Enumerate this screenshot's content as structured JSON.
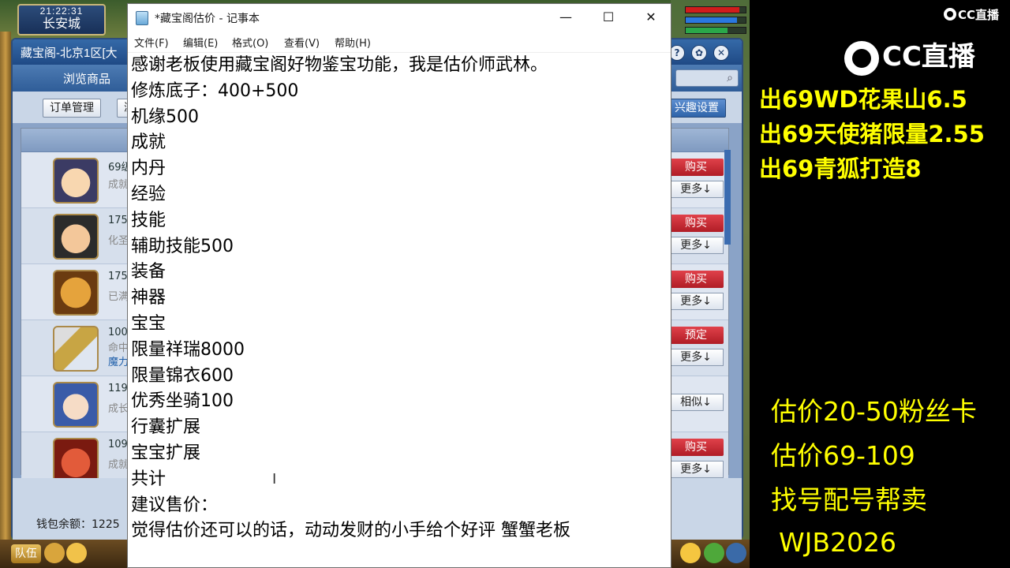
{
  "game": {
    "clock_time": "21:22:31",
    "location": "长安城",
    "cbg_window": {
      "title": "藏宝阁-北京1区[大",
      "tab_browse": "浏览商品",
      "btn_orders": "订单管理",
      "btn_partial": "浏",
      "btn_interest": "兴趣设置",
      "rows": [
        {
          "level": "69级",
          "sub": "成就",
          "buy": "购买",
          "more": "更多↓"
        },
        {
          "level": "175",
          "sub": "化圣",
          "buy": "购买",
          "more": "更多↓"
        },
        {
          "level": "175",
          "sub": "已满",
          "buy": "购买",
          "more": "更多↓"
        },
        {
          "level": "100",
          "sub": "命中",
          "sub2": "魔力",
          "buy": "预定",
          "more": "更多↓"
        },
        {
          "level": "119",
          "sub": "成长",
          "buy": "",
          "more": "相似↓"
        },
        {
          "level": "109",
          "sub": "成就",
          "buy": "购买",
          "more": "更多↓"
        }
      ],
      "wallet": "钱包余额：1225"
    },
    "team_button": "队伍"
  },
  "notepad": {
    "title": "*藏宝阁估价 - 记事本",
    "menu": [
      "文件(F)",
      "编辑(E)",
      "格式(O)",
      "查看(V)",
      "帮助(H)"
    ],
    "lines": [
      "感谢老板使用藏宝阁好物鉴宝功能，我是估价师武林。",
      "修炼底子：400+500",
      "机缘500",
      "成就",
      "内丹",
      "经验",
      "技能",
      "辅助技能500",
      "装备",
      "神器",
      "宝宝",
      "限量祥瑞8000",
      "限量锦衣600",
      "优秀坐骑100",
      "行囊扩展",
      "宝宝扩展",
      "共计",
      "建议售价：",
      "觉得估价还可以的话，动动发财的小手给个好评 蟹蟹老板"
    ]
  },
  "overlay": {
    "logo_small": "CC直播",
    "logo_big": "CC直播",
    "sell_lines": [
      "出69WD花果山6.5",
      "出69天使猪限量2.55",
      "出69青狐打造8"
    ],
    "info_lines": [
      "估价20-50粉丝卡",
      "估价69-109",
      "找号配号帮卖",
      "WJB2026"
    ],
    "text_color": "#ffff00"
  }
}
